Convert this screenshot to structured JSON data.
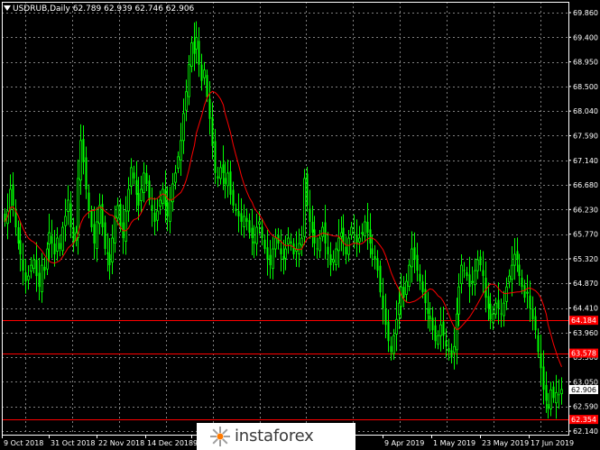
{
  "chart_data": {
    "type": "candlestick",
    "title": "USDRUB,Daily  62.789 62.939 62.746 62.906",
    "series_name": "USDRUB,Daily",
    "ohlc_label": "62.789 62.939 62.746 62.906",
    "ylim": [
      62.14,
      69.86
    ],
    "y_ticks": [
      "69.860",
      "69.400",
      "68.950",
      "68.500",
      "68.040",
      "67.590",
      "67.140",
      "66.680",
      "66.230",
      "65.770",
      "65.320",
      "64.870",
      "64.410",
      "63.960",
      "63.500",
      "63.050",
      "62.590",
      "62.140"
    ],
    "x_ticks": [
      "9 Oct 2018",
      "31 Oct 2018",
      "22 Nov 2018",
      "14 Dec 2018",
      "9 Jan 20",
      "9 Apr 2019",
      "1 May 2019",
      "23 May 2019",
      "17 Jun 2019"
    ],
    "horizontal_levels": [
      {
        "value": 64.184,
        "label": "64.184"
      },
      {
        "value": 63.578,
        "label": "63.578"
      },
      {
        "value": 62.354,
        "label": "62.354"
      }
    ],
    "current_price": {
      "value": 62.906,
      "label": "62.906"
    },
    "grid": true,
    "colors": {
      "background": "#000000",
      "grid": "#7f7f7f",
      "candle": "#00ff00",
      "moving_average": "#ff0000",
      "levels": "#ff0000",
      "axis_text": "#ffffff",
      "price_box_bg": "#ffffff",
      "price_box_text": "#000000",
      "level_box_bg": "#ff0000",
      "level_box_text": "#ffffff"
    },
    "closes": [
      66.0,
      66.2,
      66.6,
      66.3,
      65.9,
      65.6,
      65.4,
      65.1,
      64.9,
      65.0,
      65.2,
      65.3,
      65.0,
      64.8,
      65.2,
      65.1,
      65.5,
      65.8,
      65.6,
      65.4,
      65.7,
      65.5,
      65.9,
      66.1,
      66.4,
      65.9,
      65.6,
      65.8,
      66.8,
      67.5,
      67.1,
      66.6,
      66.2,
      65.9,
      65.6,
      66.0,
      66.3,
      65.9,
      65.5,
      65.4,
      65.2,
      65.7,
      66.1,
      66.3,
      65.9,
      65.7,
      66.2,
      66.6,
      67.0,
      66.8,
      66.5,
      66.3,
      66.6,
      66.9,
      66.7,
      66.4,
      66.2,
      66.0,
      66.2,
      66.4,
      66.6,
      66.3,
      66.1,
      66.4,
      66.7,
      66.9,
      67.2,
      67.5,
      68.0,
      68.4,
      68.9,
      69.3,
      69.1,
      69.4,
      68.9,
      68.6,
      68.8,
      68.3,
      67.9,
      67.4,
      66.9,
      66.8,
      67.0,
      66.9,
      66.7,
      66.9,
      66.5,
      66.3,
      66.2,
      66.1,
      66.0,
      66.1,
      66.0,
      65.8,
      65.7,
      65.6,
      65.9,
      66.0,
      65.7,
      65.5,
      65.3,
      65.2,
      65.5,
      65.7,
      65.6,
      65.4,
      65.3,
      65.5,
      65.7,
      65.6,
      65.4,
      65.5,
      65.6,
      65.7,
      66.8,
      66.3,
      66.0,
      65.8,
      65.6,
      65.5,
      65.7,
      65.9,
      65.6,
      65.4,
      65.2,
      65.3,
      65.5,
      65.7,
      65.8,
      65.6,
      65.4,
      65.7,
      65.9,
      65.8,
      65.6,
      65.7,
      65.8,
      66.0,
      65.8,
      65.6,
      65.4,
      65.3,
      65.1,
      64.7,
      64.4,
      64.1,
      63.8,
      63.6,
      63.9,
      64.2,
      64.5,
      64.8,
      64.6,
      64.9,
      65.2,
      65.5,
      65.3,
      65.1,
      64.9,
      64.7,
      64.5,
      64.3,
      64.2,
      64.0,
      63.8,
      63.9,
      64.1,
      63.9,
      63.7,
      63.6,
      63.5,
      63.7,
      64.3,
      64.8,
      65.2,
      65.1,
      65.0,
      64.8,
      64.9,
      65.1,
      65.3,
      65.2,
      65.0,
      64.6,
      64.4,
      64.2,
      64.3,
      64.5,
      64.4,
      64.3,
      64.5,
      64.8,
      65.0,
      65.2,
      65.4,
      65.3,
      65.0,
      64.8,
      64.6,
      64.7,
      64.4,
      64.2,
      64.0,
      63.6,
      63.3,
      62.9,
      62.7,
      62.55,
      62.9,
      62.75,
      62.85,
      62.8,
      62.906
    ]
  },
  "watermark": {
    "text": "instaforex",
    "icon": "instaforex-logo-icon"
  }
}
